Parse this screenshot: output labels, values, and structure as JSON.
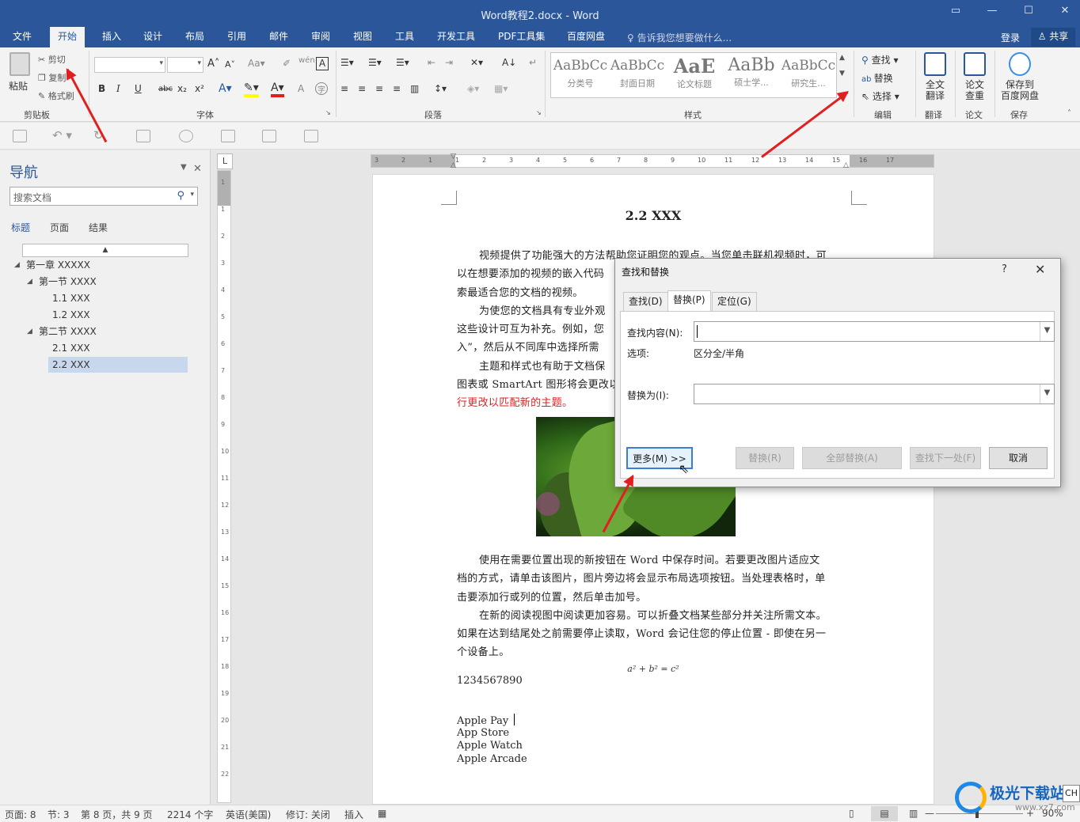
{
  "window": {
    "title": "Word教程2.docx - Word"
  },
  "tabs": [
    "文件",
    "开始",
    "插入",
    "设计",
    "布局",
    "引用",
    "邮件",
    "审阅",
    "视图",
    "工具",
    "开发工具",
    "PDF工具集",
    "百度网盘"
  ],
  "tell_me": "告诉我您想要做什么...",
  "login": "登录",
  "share": "共享",
  "ribbon": {
    "clipboard": {
      "paste": "粘贴",
      "cut": "剪切",
      "copy": "复制",
      "format_painter": "格式刷",
      "label": "剪贴板"
    },
    "font": {
      "label": "字体",
      "bold": "B",
      "italic": "I",
      "underline": "U",
      "strike": "abc",
      "sub": "x₂",
      "sup": "x²"
    },
    "paragraph": {
      "label": "段落"
    },
    "styles": {
      "label": "样式",
      "items": [
        {
          "sample": "AaBbCc",
          "name": "分类号"
        },
        {
          "sample": "AaBbCc",
          "name": "封面日期"
        },
        {
          "sample": "AaE",
          "name": "论文标题"
        },
        {
          "sample": "AaBb",
          "name": "硕士学..."
        },
        {
          "sample": "AaBbCc",
          "name": "研究生..."
        }
      ]
    },
    "editing": {
      "label": "编辑",
      "find": "查找",
      "replace": "替换",
      "select": "选择"
    },
    "translate": {
      "label": "翻译",
      "button_line1": "全文",
      "button_line2": "翻译"
    },
    "paper": {
      "label": "论文",
      "button_line1": "论文",
      "button_line2": "查重"
    },
    "save": {
      "label": "保存",
      "button_line1": "保存到",
      "button_line2": "百度网盘"
    }
  },
  "nav": {
    "title": "导航",
    "search_placeholder": "搜索文档",
    "tabs": [
      "标题",
      "页面",
      "结果"
    ],
    "tree": [
      {
        "label": "第一章 XXXXX",
        "level": 0,
        "expanded": true
      },
      {
        "label": "第一节 XXXX",
        "level": 1,
        "expanded": true
      },
      {
        "label": "1.1 XXX",
        "level": 2
      },
      {
        "label": "1.2 XXX",
        "level": 2
      },
      {
        "label": "第二节 XXXX",
        "level": 1,
        "expanded": true
      },
      {
        "label": "2.1 XXX",
        "level": 2
      },
      {
        "label": "2.2 XXX",
        "level": 2,
        "selected": true
      }
    ]
  },
  "ruler": {
    "h_ticks": [
      "3",
      "2",
      "1",
      "1",
      "2",
      "3",
      "4",
      "5",
      "6",
      "7",
      "8",
      "9",
      "10",
      "11",
      "12",
      "13",
      "14",
      "15",
      "16",
      "17"
    ],
    "v_ticks": [
      "1",
      "1",
      "2",
      "3",
      "4",
      "5",
      "6",
      "7",
      "8",
      "9",
      "10",
      "11",
      "12",
      "13",
      "14",
      "15",
      "16",
      "17",
      "18",
      "19",
      "20",
      "21",
      "22"
    ],
    "corner": "L"
  },
  "document": {
    "heading": "2.2 XXX",
    "p1": [
      "视频提供了功能强大的方法帮助您证明您的观点。当您单击联机视频时，可",
      "以在想要添加的视频的嵌入代码",
      "索最适合您的文档的视频。"
    ],
    "p2": [
      "为使您的文档具有专业外观",
      "这些设计可互为补充。例如，您",
      "入”，然后从不同库中选择所需"
    ],
    "p3": [
      "主题和样式也有助于文档保",
      "图表或 SmartArt 图形将会更改以"
    ],
    "p3_red": "行更改以匹配新的主题。",
    "p4": [
      "使用在需要位置出现的新按钮在 Word 中保存时间。若要更改图片适应文",
      "档的方式，请单击该图片，图片旁边将会显示布局选项按钮。当处理表格时，单",
      "击要添加行或列的位置，然后单击加号。"
    ],
    "p5": [
      "在新的阅读视图中阅读更加容易。可以折叠文档某些部分并关注所需文本。",
      "如果在达到结尾处之前需要停止读取，Word 会记住您的停止位置 - 即使在另一",
      "个设备上。"
    ],
    "equation": "a² + b² = c²",
    "number_line": "1234567890",
    "list": [
      "Apple Pay",
      "App Store",
      "Apple Watch",
      "Apple Arcade"
    ]
  },
  "dialog": {
    "title": "查找和替换",
    "help": "?",
    "close": "✕",
    "tabs": [
      "查找(D)",
      "替换(P)",
      "定位(G)"
    ],
    "find_label": "查找内容(N):",
    "find_value": "",
    "options_label": "选项:",
    "options_value": "区分全/半角",
    "replace_label": "替换为(I):",
    "replace_value": "",
    "buttons": {
      "more": "更多(M) >>",
      "replace": "替换(R)",
      "replace_all": "全部替换(A)",
      "find_next": "查找下一处(F)",
      "cancel": "取消"
    }
  },
  "status": {
    "page": "页面: 8",
    "section": "节: 3",
    "page_of": "第 8 页，共 9 页",
    "words": "2214 个字",
    "language": "英语(美国)",
    "track": "修订: 关闭",
    "insert": "插入",
    "zoom": "90%"
  },
  "watermark": {
    "text": "极光下载站",
    "url": "www.xz7.com"
  },
  "ch_badge": "CH",
  "colors": {
    "accent": "#2b579a",
    "annotation": "#e02020",
    "red_text": "#d22222"
  }
}
